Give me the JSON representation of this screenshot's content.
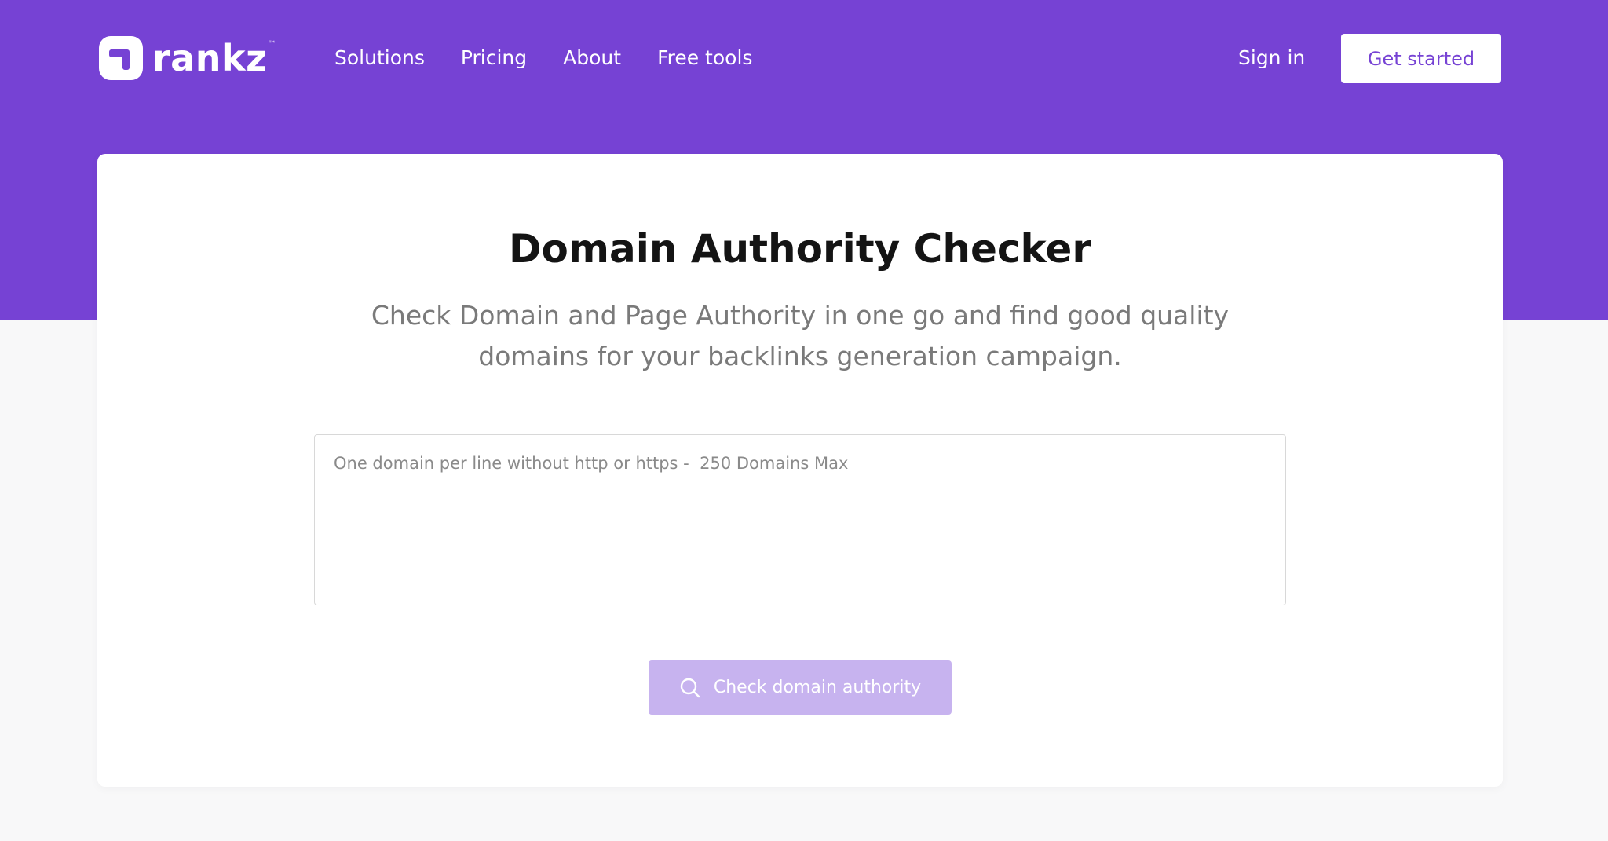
{
  "brand": {
    "name": "rankz",
    "trademark": "™",
    "primary_color": "#7642d4",
    "button_disabled_color": "#c7b3ef"
  },
  "nav": {
    "links": [
      {
        "label": "Solutions"
      },
      {
        "label": "Pricing"
      },
      {
        "label": "About"
      },
      {
        "label": "Free tools"
      }
    ],
    "sign_in_label": "Sign in",
    "get_started_label": "Get started"
  },
  "tool": {
    "title": "Domain Authority Checker",
    "subtitle": "Check Domain and Page Authority in one go and find good quality domains for your backlinks generation campaign.",
    "input": {
      "value": "",
      "placeholder": "One domain per line without http or https -  250 Domains Max"
    },
    "submit_label": "Check domain authority",
    "submit_icon": "search-icon"
  }
}
